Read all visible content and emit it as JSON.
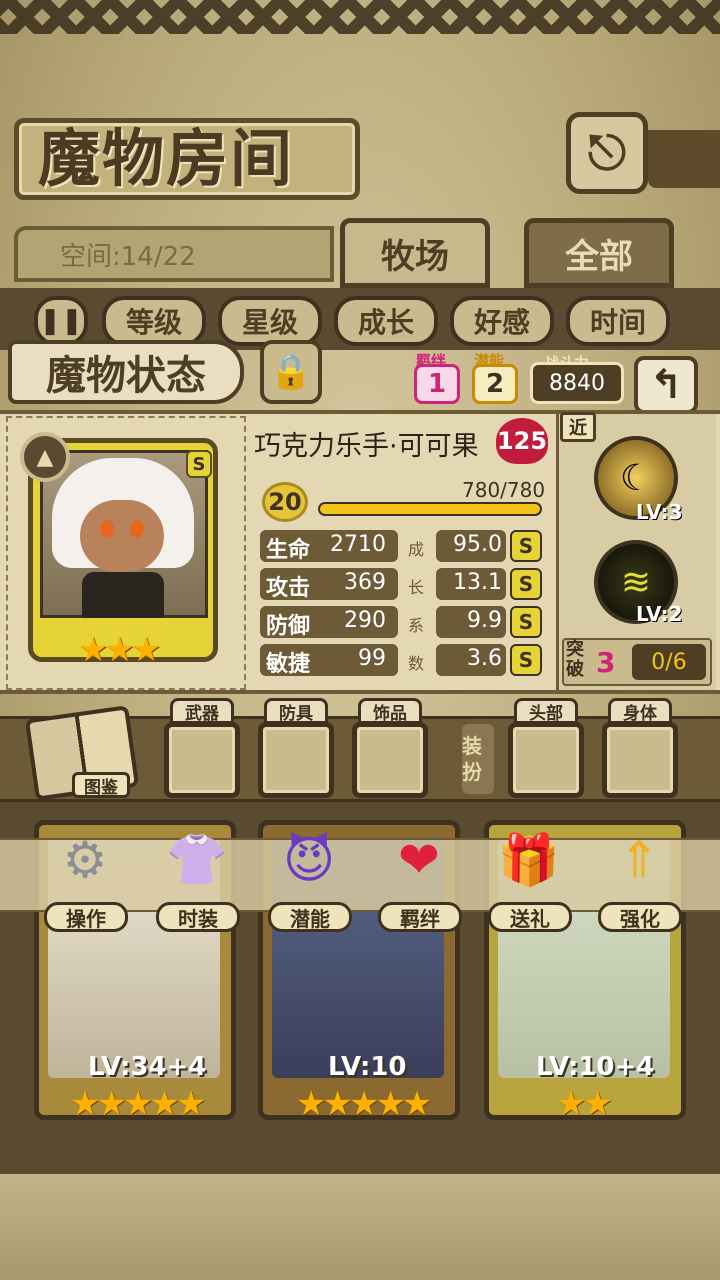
{
  "screen": {
    "title": "魔物房间",
    "space": "空间:14/22",
    "tabs": [
      "牧场",
      "全部"
    ],
    "sort_buttons": [
      "等级",
      "星级",
      "成长",
      "好感",
      "时间"
    ]
  },
  "status": {
    "label": "魔物状态",
    "bond_label": "羁绊",
    "bond_value": "1",
    "potential_label": "潜能",
    "potential_value": "2",
    "power_label": "战斗力",
    "power_value": "8840"
  },
  "character": {
    "name": "巧克力乐手·可可果",
    "level_cap": "125",
    "level": "20",
    "exp_text": "780/780",
    "exp_fraction": 1.0,
    "grade": "S",
    "stars": "★★★",
    "stats": [
      {
        "label": "生命",
        "value": "2710",
        "growth": "95.0",
        "grade": "S"
      },
      {
        "label": "攻击",
        "value": "369",
        "growth": "13.1",
        "grade": "S"
      },
      {
        "label": "防御",
        "value": "290",
        "growth": "9.9",
        "grade": "S"
      },
      {
        "label": "敏捷",
        "value": "99",
        "growth": "3.6",
        "grade": "S"
      }
    ],
    "growth_chars": [
      "成",
      "长",
      "系",
      "数"
    ]
  },
  "skills": {
    "range_tag": "近",
    "skill1_lv": "LV:3",
    "skill2_lv": "LV:2",
    "breakthrough_label": "突破",
    "breakthrough_level": "3",
    "breakthrough_progress": "0/6"
  },
  "equipment": {
    "book_label": "图鉴",
    "slots": [
      "武器",
      "防具",
      "饰品",
      "头部",
      "身体"
    ],
    "dress_label": "装扮"
  },
  "actions": [
    "操作",
    "时装",
    "潜能",
    "羁绊",
    "送礼",
    "强化"
  ],
  "cards": [
    {
      "lv": "LV:34+4",
      "stars": "★★★★★"
    },
    {
      "lv": "LV:10",
      "stars": "★★★★★"
    },
    {
      "lv": "LV:10+4",
      "stars": "★★"
    }
  ],
  "colors": {
    "parchment": "#d6c9a0",
    "dark_brown": "#3e3120",
    "gold": "#e6d437",
    "heart_red": "#c21c3c"
  }
}
